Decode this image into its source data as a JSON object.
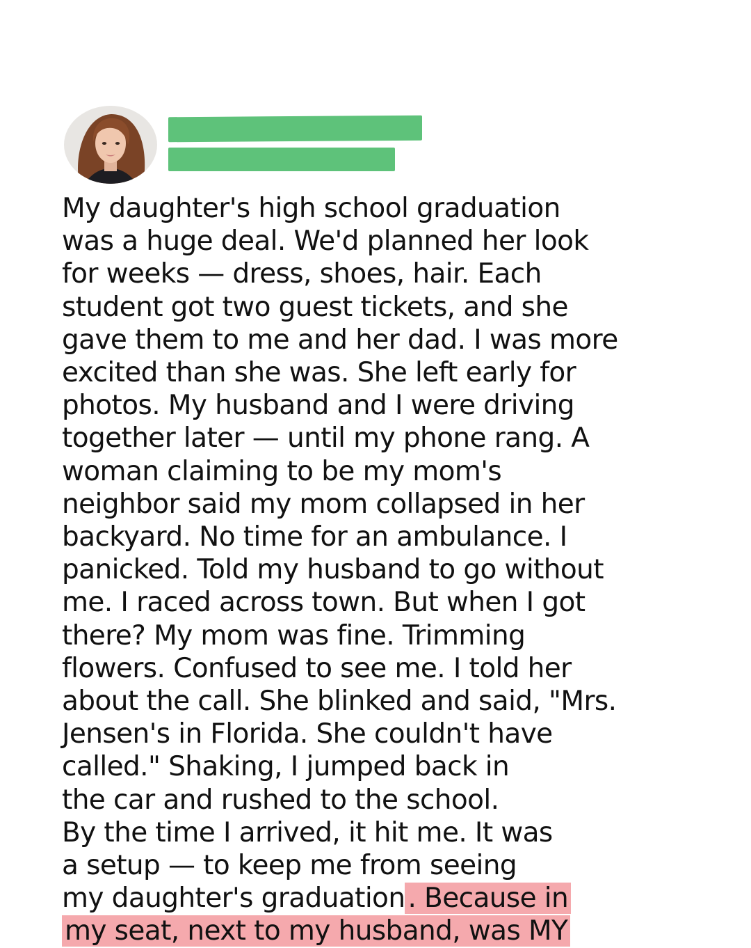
{
  "post": {
    "author_name": "",
    "author_handle": "",
    "story_text": "My daughter's high school graduation\nwas a huge deal. We'd planned her look\nfor weeks — dress, shoes, hair. Each\nstudent got two guest tickets, and she\ngave them to me and her dad. I was more\nexcited than she was. She left early for\nphotos. My husband and I were driving\ntogether later — until my phone rang. A\nwoman claiming to be my mom's\nneighbor said my mom collapsed in her\nbackyard. No time for an ambulance. I\npanicked. Told my husband to go without\nme. I raced across town. But when I got\nthere? My mom was fine. Trimming\nflowers. Confused to see me. I told her\nabout the call. She blinked and said, \"Mrs.\nJensen's in Florida. She couldn't have\ncalled.\" Shaking, I jumped back in\nthe car and rushed to the school.\nBy the time I arrived, it hit me. It was\na setup — to keep me from seeing\nmy daughter's graduation",
    "highlighted_text": ". Because in\nmy seat, next to my husband, was MY"
  },
  "colors": {
    "redaction": "#5ec27a",
    "highlight": "#f5a9ad",
    "text": "#111111",
    "background": "#ffffff"
  }
}
